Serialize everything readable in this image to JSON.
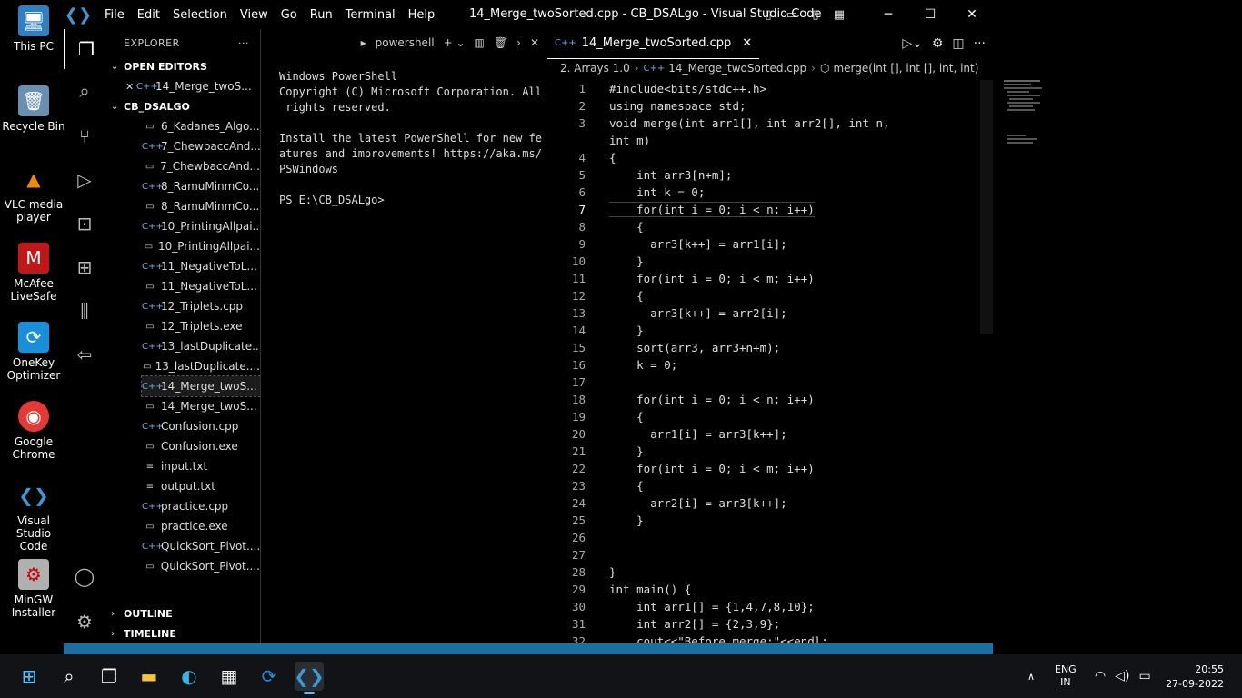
{
  "desktop": {
    "icons": [
      {
        "label": "This PC",
        "icon": "computer-icon"
      },
      {
        "label": "Recycle Bin",
        "icon": "recycle-bin-icon"
      },
      {
        "label": "VLC media\nplayer",
        "icon": "vlc-icon"
      },
      {
        "label": "McAfee\nLiveSafe",
        "icon": "mcafee-icon"
      },
      {
        "label": "OneKey\nOptimizer",
        "icon": "onekey-icon"
      },
      {
        "label": "Google\nChrome",
        "icon": "chrome-icon"
      },
      {
        "label": "Visual Studio\nCode",
        "icon": "vscode-icon"
      },
      {
        "label": "MinGW\nInstaller",
        "icon": "mingw-icon"
      }
    ]
  },
  "window": {
    "title": "14_Merge_twoSorted.cpp - CB_DSALgo - Visual Studio Code",
    "menu": [
      "File",
      "Edit",
      "Selection",
      "View",
      "Go",
      "Run",
      "Terminal",
      "Help"
    ]
  },
  "sidebar": {
    "header": "EXPLORER",
    "open_editors_label": "OPEN EDITORS",
    "open_editor_file": "14_Merge_twoS...",
    "folder_label": "CB_DSALGO",
    "files": [
      {
        "name": "6_Kadanes_Algo...",
        "type": "exe"
      },
      {
        "name": "7_ChewbaccAnd...",
        "type": "cpp"
      },
      {
        "name": "7_ChewbaccAnd...",
        "type": "exe"
      },
      {
        "name": "8_RamuMinmCo...",
        "type": "cpp"
      },
      {
        "name": "8_RamuMinmCo...",
        "type": "exe"
      },
      {
        "name": "10_PrintingAllpai...",
        "type": "cpp"
      },
      {
        "name": "10_PrintingAllpai...",
        "type": "exe"
      },
      {
        "name": "11_NegativeToL...",
        "type": "cpp"
      },
      {
        "name": "11_NegativeToL...",
        "type": "exe"
      },
      {
        "name": "12_Triplets.cpp",
        "type": "cpp"
      },
      {
        "name": "12_Triplets.exe",
        "type": "exe"
      },
      {
        "name": "13_lastDuplicate....",
        "type": "cpp"
      },
      {
        "name": "13_lastDuplicate....",
        "type": "exe"
      },
      {
        "name": "14_Merge_twoS...",
        "type": "cpp"
      },
      {
        "name": "14_Merge_twoS...",
        "type": "exe"
      },
      {
        "name": "Confusion.cpp",
        "type": "cpp"
      },
      {
        "name": "Confusion.exe",
        "type": "exe"
      },
      {
        "name": "input.txt",
        "type": "txt"
      },
      {
        "name": "output.txt",
        "type": "txt"
      },
      {
        "name": "practice.cpp",
        "type": "cpp"
      },
      {
        "name": "practice.exe",
        "type": "exe"
      },
      {
        "name": "QuickSort_Pivot....",
        "type": "cpp"
      },
      {
        "name": "QuickSort_Pivot....",
        "type": "exe"
      }
    ],
    "outline_label": "OUTLINE",
    "timeline_label": "TIMELINE"
  },
  "terminal": {
    "shell": "powershell",
    "output": "Windows PowerShell\nCopyright (C) Microsoft Corporation. All\n rights reserved.\n\nInstall the latest PowerShell for new fe\natures and improvements! https://aka.ms/\nPSWindows\n\nPS E:\\CB_DSALgo>"
  },
  "editor": {
    "tab_label": "14_Merge_twoSorted.cpp",
    "breadcrumb": [
      "2. Arrays 1.0",
      "14_Merge_twoSorted.cpp",
      "merge(int [], int [], int, int)"
    ],
    "current_line": 7,
    "lines": [
      {
        "n": "1",
        "text": "#include<bits/stdc++.h>"
      },
      {
        "n": "2",
        "text": "using namespace std;"
      },
      {
        "n": "3",
        "text": "void merge(int arr1[], int arr2[], int n,"
      },
      {
        "n": "",
        "text": "int m)"
      },
      {
        "n": "4",
        "text": "{"
      },
      {
        "n": "5",
        "text": "    int arr3[n+m];"
      },
      {
        "n": "6",
        "text": "    int k = 0;"
      },
      {
        "n": "7",
        "text": "    for(int i = 0; i < n; i++)"
      },
      {
        "n": "8",
        "text": "    {"
      },
      {
        "n": "9",
        "text": "      arr3[k++] = arr1[i];"
      },
      {
        "n": "10",
        "text": "    }"
      },
      {
        "n": "11",
        "text": "    for(int i = 0; i < m; i++)"
      },
      {
        "n": "12",
        "text": "    {"
      },
      {
        "n": "13",
        "text": "      arr3[k++] = arr2[i];"
      },
      {
        "n": "14",
        "text": "    }"
      },
      {
        "n": "15",
        "text": "    sort(arr3, arr3+n+m);"
      },
      {
        "n": "16",
        "text": "    k = 0;"
      },
      {
        "n": "17",
        "text": ""
      },
      {
        "n": "18",
        "text": "    for(int i = 0; i < n; i++)"
      },
      {
        "n": "19",
        "text": "    {"
      },
      {
        "n": "20",
        "text": "      arr1[i] = arr3[k++];"
      },
      {
        "n": "21",
        "text": "    }"
      },
      {
        "n": "22",
        "text": "    for(int i = 0; i < m; i++)"
      },
      {
        "n": "23",
        "text": "    {"
      },
      {
        "n": "24",
        "text": "      arr2[i] = arr3[k++];"
      },
      {
        "n": "25",
        "text": "    }"
      },
      {
        "n": "26",
        "text": ""
      },
      {
        "n": "27",
        "text": ""
      },
      {
        "n": "28",
        "text": "}"
      },
      {
        "n": "29",
        "text": "int main() {"
      },
      {
        "n": "30",
        "text": "    int arr1[] = {1,4,7,8,10};"
      },
      {
        "n": "31",
        "text": "    int arr2[] = {2,3,9};"
      },
      {
        "n": "32",
        "text": "    cout<<\"Before merge:\"<<endl;"
      }
    ]
  },
  "taskbar": {
    "apps": [
      "start-icon",
      "search-icon",
      "task-view-icon",
      "file-explorer-icon",
      "edge-icon",
      "store-icon",
      "onekey-icon",
      "vscode-icon"
    ],
    "language": "ENG",
    "region": "IN",
    "time": "20:55",
    "date": "27-09-2022"
  },
  "colors": {
    "accent": "#3c99d4",
    "statusbar": "#1a6fa3"
  }
}
